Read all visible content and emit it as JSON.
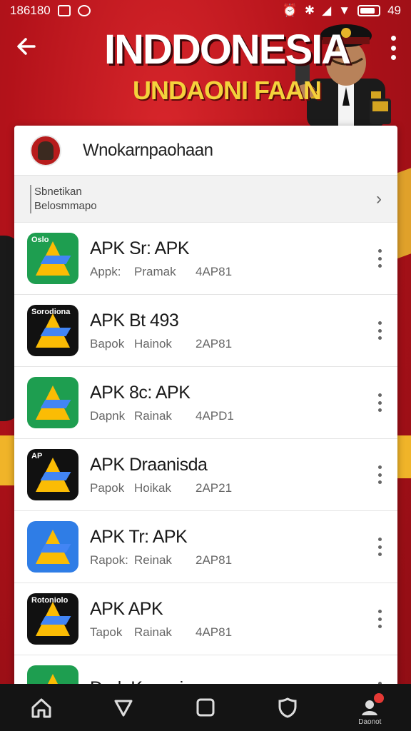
{
  "status_bar": {
    "time": "186180",
    "battery": "49"
  },
  "banner": {
    "title": "INDDONESIA",
    "subtitle": "UNDAONI FAAN"
  },
  "card": {
    "title": "Wnokarnpaohaan",
    "info_line1": "Sbnetikan",
    "info_line2": "Belosmmapo"
  },
  "apps": [
    {
      "name": "APK Sr: APK",
      "meta1": "Appk:",
      "meta2": "Pramak",
      "meta3": "4AP81",
      "icon_label": "Oslo",
      "bg": "#1e9e50"
    },
    {
      "name": "APK Bt 493",
      "meta1": "Bapok",
      "meta2": "Hainok",
      "meta3": "2AP81",
      "icon_label": "Sorodiona",
      "bg": "#111111"
    },
    {
      "name": "APK 8c: APK",
      "meta1": "Dapnk",
      "meta2": "Rainak",
      "meta3": "4APD1",
      "icon_label": "",
      "bg": "#1e9e50"
    },
    {
      "name": "APK Draanisda",
      "meta1": "Papok",
      "meta2": "Hoikak",
      "meta3": "2AP21",
      "icon_label": "AP",
      "bg": "#111111"
    },
    {
      "name": "APK Tr: APK",
      "meta1": "Rapok:",
      "meta2": "Reinak",
      "meta3": "2AP81",
      "icon_label": "",
      "bg": "#2f7de6"
    },
    {
      "name": "APK APK",
      "meta1": "Tapok",
      "meta2": "Rainak",
      "meta3": "4AP81",
      "icon_label": "Rotoniolo",
      "bg": "#111111"
    },
    {
      "name": "Dark Kenasiaro",
      "meta1": "",
      "meta2": "",
      "meta3": "",
      "icon_label": "",
      "bg": "#1e9e50"
    }
  ],
  "nav": {
    "profile_label": "Daonot"
  }
}
